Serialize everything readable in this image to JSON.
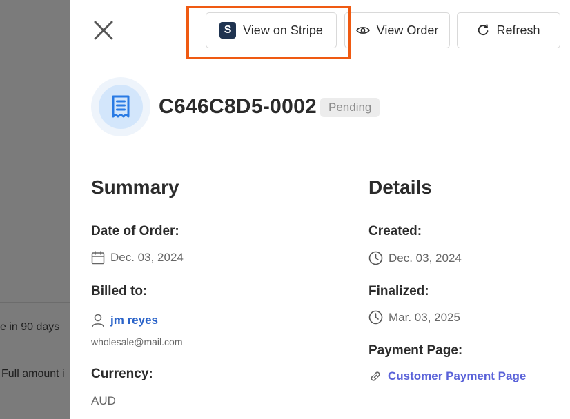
{
  "background": {
    "line1": "e in 90 days",
    "line2": "Full amount i"
  },
  "header": {
    "close_icon": "close-icon",
    "view_on_stripe_label": "View on Stripe",
    "stripe_logo_letter": "S",
    "view_order_label": "View Order",
    "refresh_label": "Refresh"
  },
  "invoice": {
    "id": "C646C8D5-0002",
    "status": "Pending",
    "icon": "receipt-icon"
  },
  "summary": {
    "title": "Summary",
    "date_label": "Date of Order:",
    "date_value": "Dec. 03, 2024",
    "billed_label": "Billed to:",
    "billed_name": "jm reyes",
    "billed_email": "wholesale@mail.com",
    "currency_label": "Currency:",
    "currency_value": "AUD"
  },
  "details": {
    "title": "Details",
    "created_label": "Created:",
    "created_value": "Dec. 03, 2024",
    "finalized_label": "Finalized:",
    "finalized_value": "Mar. 03, 2025",
    "payment_label": "Payment Page:",
    "payment_link": "Customer Payment Page"
  },
  "colors": {
    "highlight": "#ef5a12",
    "link": "#2a63c9",
    "payment_link": "#5b63d9",
    "stripe_brand": "#1f3350"
  }
}
